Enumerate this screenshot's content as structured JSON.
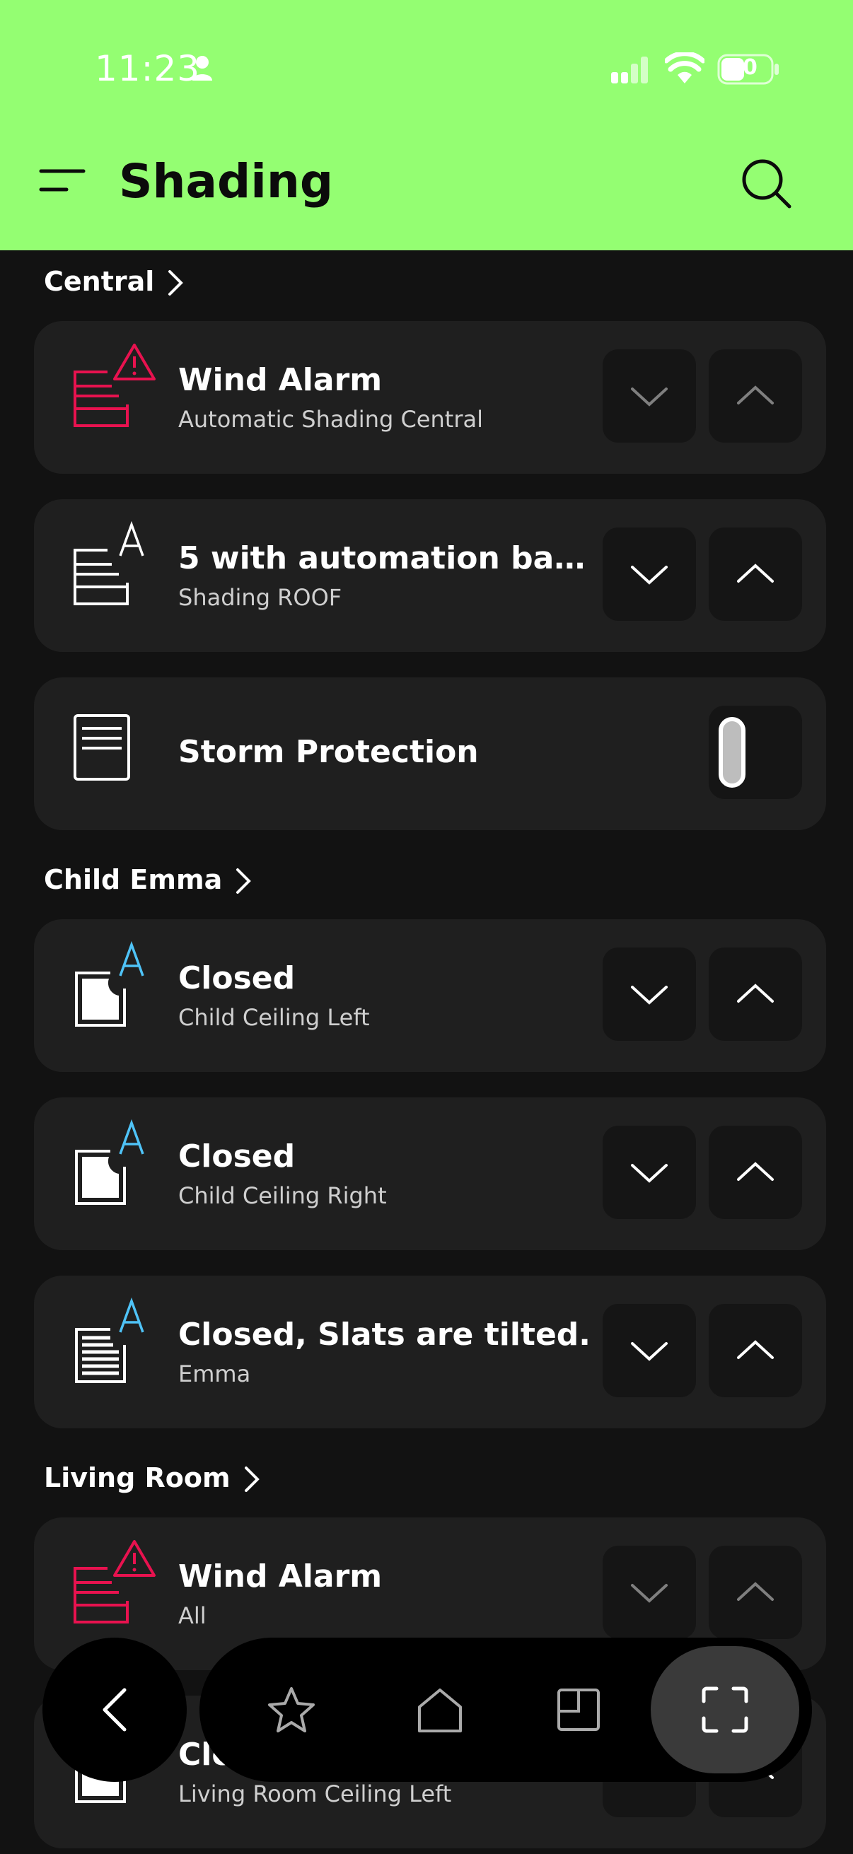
{
  "status_bar": {
    "time": "11:23",
    "battery": "40"
  },
  "header": {
    "title": "Shading"
  },
  "sections": [
    {
      "title": "Central"
    },
    {
      "title": "Child Emma"
    },
    {
      "title": "Living Room"
    }
  ],
  "cards": [
    {
      "title": "Wind Alarm",
      "subtitle": "Automatic Shading Central",
      "icon": "shading-alarm-icon"
    },
    {
      "title": "5 with automation base...",
      "subtitle": "Shading ROOF",
      "icon": "shading-auto-icon"
    },
    {
      "title": "Storm Protection",
      "subtitle": "",
      "icon": "shading-icon",
      "toggle": true
    },
    {
      "title": "Closed",
      "subtitle": "Child Ceiling Left",
      "icon": "roof-window-auto-icon"
    },
    {
      "title": "Closed",
      "subtitle": "Child Ceiling Right",
      "icon": "roof-window-auto-icon"
    },
    {
      "title": "Closed, Slats are tilted.",
      "subtitle": "Emma",
      "icon": "blinds-auto-icon"
    },
    {
      "title": "Wind Alarm",
      "subtitle": "All",
      "icon": "shading-alarm-icon"
    },
    {
      "title": "Clo",
      "subtitle": "Living Room Ceiling Left",
      "icon": "roof-window-icon"
    }
  ],
  "colors": {
    "accent": "#94fe72",
    "alarm": "#e8124f",
    "auto": "#4fc3f7"
  },
  "navbar": {
    "items": [
      "back-icon",
      "star-icon",
      "home-icon",
      "rooms-icon",
      "scan-icon"
    ]
  }
}
